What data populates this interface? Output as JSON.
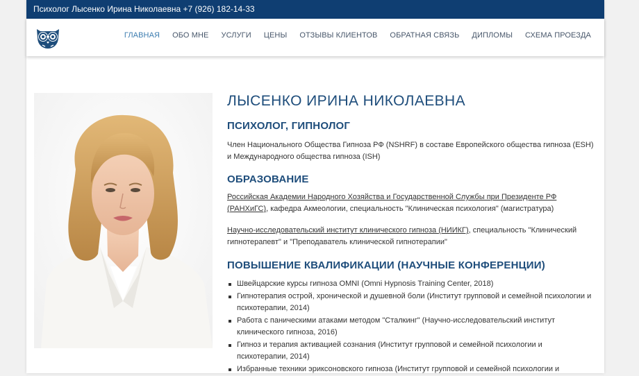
{
  "topbar": {
    "text": "Психолог Лысенко Ирина Николаевна +7 (926) 182-14-33"
  },
  "nav": {
    "items": [
      {
        "label": "ГЛАВНАЯ",
        "active": true
      },
      {
        "label": "ОБО МНЕ"
      },
      {
        "label": "УСЛУГИ"
      },
      {
        "label": "ЦЕНЫ"
      },
      {
        "label": "ОТЗЫВЫ КЛИЕНТОВ"
      },
      {
        "label": "ОБРАТНАЯ СВЯЗЬ"
      },
      {
        "label": "ДИПЛОМЫ"
      },
      {
        "label": "СХЕМА ПРОЕЗДА"
      }
    ]
  },
  "logo": {
    "icon": "owl-glasses-icon",
    "color": "#1e4d7b"
  },
  "profile": {
    "name": "ЛЫСЕНКО ИРИНА НИКОЛАЕВНА",
    "role": "ПСИХОЛОГ, ГИПНОЛОГ",
    "membership": "Член Национального Общества Гипноза РФ (NSHRF) в составе Европейского общества гипноза (ESH)  и Международного общества гипноза (ISH)"
  },
  "education": {
    "heading": "ОБРАЗОВАНИЕ",
    "items": [
      {
        "link": "Российская Академии Народного Хозяйства и Государственной Службы при Президенте РФ (РАНХиГС)",
        "text": ", кафедра Акмеологии, специальность \"Клиническая психология\" (магистратура)"
      },
      {
        "link": "Научно-исследовательский институт клинического гипноза (НИИКГ)",
        "text": ", специальность \"Клинический гипнотерапевт\" и \"Преподаватель клинической гипнотерапии\""
      }
    ]
  },
  "qualification": {
    "heading": "ПОВЫШЕНИЕ КВАЛИФИКАЦИИ (НАУЧНЫЕ КОНФЕРЕНЦИИ)",
    "items": [
      "Швейцарские курсы гипноза OMNI (Omni Hypnosis Training Center, 2018)",
      "Гипнотерапия острой, хронической и душевной боли (Институт групповой и семейной психологии и психотерапии, 2014)",
      "Работа с паническими атаками методом \"Сталкинг\" (Научно-исследовательский институт клинического гипноза, 2016)",
      "Гипноз и терапия активацией сознания (Институт групповой и семейной психологии и психотерапии, 2014)",
      "Избранные техники эриксоновского гипноза (Институт групповой и семейной психологии и"
    ]
  },
  "colors": {
    "topbar": "#0f3e72",
    "heading": "#1e4d7b",
    "nav_active": "#3d7db0"
  }
}
